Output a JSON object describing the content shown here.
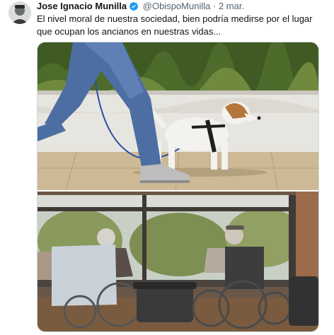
{
  "tweet": {
    "author_name": "Jose Ignacio Munilla",
    "handle": "@ObispoMunilla",
    "separator": "·",
    "date": "2 mar.",
    "text": "El nivel moral de nuestra sociedad, bien podría medirse por el lugar que ocupan los ancianos en nuestras vidas...",
    "verified_icon": "verified-badge-icon",
    "accent_color": "#1d9bf0"
  },
  "media": [
    {
      "name": "photo-person-walking-dog"
    },
    {
      "name": "photo-elderly-in-wheelchairs"
    }
  ]
}
